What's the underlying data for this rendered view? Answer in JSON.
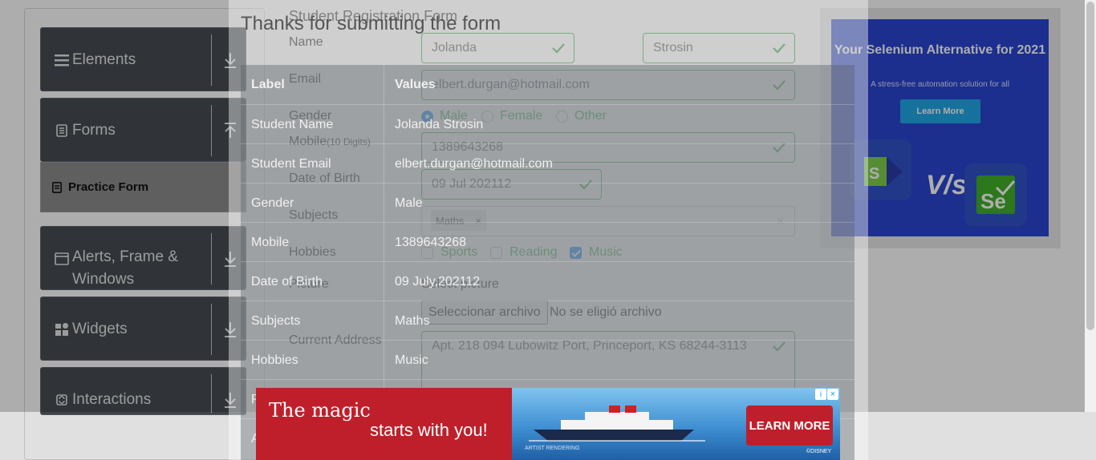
{
  "sidebar": {
    "groups": [
      {
        "label": "Elements",
        "icon": "hamburger-icon"
      },
      {
        "label": "Forms",
        "icon": "document-icon"
      },
      {
        "label": "Alerts, Frame & Windows",
        "icon": "window-icon"
      },
      {
        "label": "Widgets",
        "icon": "grid-icon"
      },
      {
        "label": "Interactions",
        "icon": "interaction-icon"
      }
    ],
    "active_item": {
      "label": "Practice Form",
      "icon": "clipboard-icon"
    }
  },
  "form": {
    "title": "Student Registration Form",
    "name_label": "Name",
    "first_name": "Jolanda",
    "last_name": "Strosin",
    "email_label": "Email",
    "email": "elbert.durgan@hotmail.com",
    "gender_label": "Gender",
    "genders": [
      "Male",
      "Female",
      "Other"
    ],
    "mobile_label": "Mobile",
    "mobile_hint": "(10 Digits)",
    "mobile": "1389643268",
    "dob_label": "Date of Birth",
    "dob": "09 Jul 202112",
    "subjects_label": "Subjects",
    "subject_tag": "Maths",
    "tag_remove": "×",
    "clear": "×",
    "hobbies_label": "Hobbies",
    "hobbies": [
      "Sports",
      "Reading",
      "Music"
    ],
    "picture_label": "Picture",
    "select_picture": "Select picture",
    "file_button": "Seleccionar archivo",
    "file_status": "No se eligió archivo",
    "address_label": "Current Address",
    "address": "Apt. 218 094 Lubowitz Port, Princeport, KS 68244-3113"
  },
  "modal": {
    "title": "Thanks for submitting the form",
    "headers": [
      "Label",
      "Values"
    ],
    "rows": [
      [
        "Student Name",
        "Jolanda Strosin"
      ],
      [
        "Student Email",
        "elbert.durgan@hotmail.com"
      ],
      [
        "Gender",
        "Male"
      ],
      [
        "Mobile",
        "1389643268"
      ],
      [
        "Date of Birth",
        "09 July,202112"
      ],
      [
        "Subjects",
        "Maths"
      ],
      [
        "Hobbies",
        "Music"
      ],
      [
        "P",
        ""
      ],
      [
        "A",
        ""
      ]
    ]
  },
  "side_ad": {
    "headline": "Your Selenium Alternative for 2021",
    "subtext": "A stress-free automation solution for all",
    "button": "Learn More",
    "vs": "V/s",
    "brand_color": "#2a46d1"
  },
  "bottom_ad": {
    "line1": "The magic",
    "line2": "starts with you!",
    "button": "LEARN MORE",
    "rendering_note": "ARTIST RENDERING",
    "brand": "©DISNEY",
    "adchoices": "i",
    "close": "×",
    "brand_color": "#bf1f2b"
  }
}
